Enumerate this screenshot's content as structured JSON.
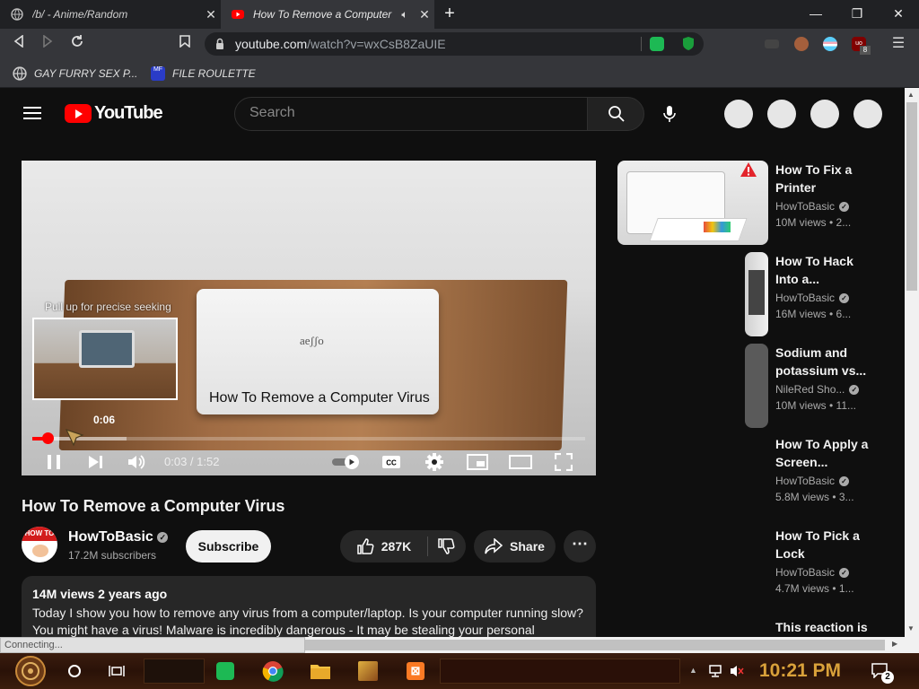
{
  "browser": {
    "tabs": [
      {
        "title": "/b/ - Anime/Random"
      },
      {
        "title": "How To Remove a Computer"
      }
    ],
    "url_host": "youtube.com",
    "url_path": "/watch?v=wxCsB8ZaUIE",
    "bookmarks": [
      {
        "label": "GAY FURRY SEX P..."
      },
      {
        "label": "FILE ROULETTE"
      }
    ],
    "status_text": "Connecting..."
  },
  "youtube": {
    "logo_text": "YouTube",
    "search_placeholder": "Search"
  },
  "player": {
    "seek_hint": "Pull up for precise seeking",
    "caption": "How To Remove a Computer Virus",
    "laptop_brand": "oʃʃǝɐ",
    "preview_time": "0:06",
    "time_display": "0:03 / 1:52",
    "progress_fraction": 0.027,
    "buffered_fraction": 0.17
  },
  "video": {
    "title": "How To Remove a Computer Virus",
    "channel_name": "HowToBasic",
    "subscribers": "17.2M subscribers",
    "avatar_text": "HOW TO BASIC",
    "subscribe_label": "Subscribe",
    "likes": "287K",
    "share_label": "Share",
    "more_label": "⋯",
    "meta": "14M views  2 years ago",
    "description_line1": "Today I show you how to remove any virus from a computer/laptop. Is your computer running slow?",
    "description_line2": "You might have a virus! Malware is incredibly dangerous - It may be stealing your personal"
  },
  "sidebar": [
    {
      "title": "How To Fix a Printer",
      "channel": "HowToBasic",
      "views": "10M views  • 2..."
    },
    {
      "title": "How To Hack Into a...",
      "channel": "HowToBasic",
      "views": "16M views  • 6..."
    },
    {
      "title": "Sodium and potassium vs...",
      "channel": "NileRed Sho...",
      "views": "10M views  • 11..."
    },
    {
      "title": "How To Apply a Screen...",
      "channel": "HowToBasic",
      "views": "5.8M views  • 3..."
    },
    {
      "title": "How To Pick a Lock",
      "channel": "HowToBasic",
      "views": "4.7M views  • 1..."
    },
    {
      "title": "This reaction is",
      "channel": "",
      "views": ""
    }
  ],
  "taskbar": {
    "clock": "10:21 PM",
    "notification_count": "2"
  },
  "colors": {
    "youtube_red": "#ff0000",
    "background": "#0f0f0f",
    "clock": "#d9a13a"
  }
}
